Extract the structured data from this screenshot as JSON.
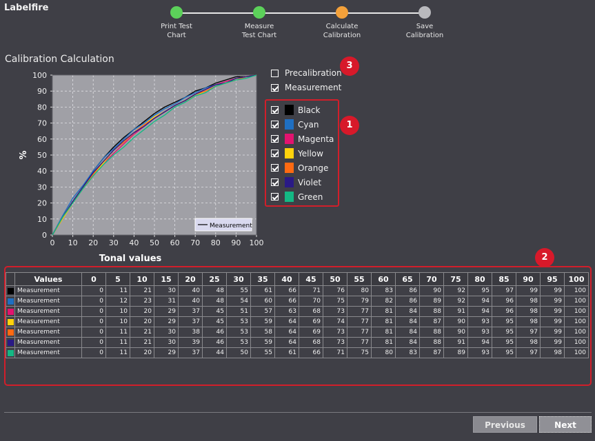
{
  "app": {
    "title": "Labelfire"
  },
  "stepper": {
    "steps": [
      {
        "label": "Print Test\nChart",
        "status": "done",
        "color": "#5cd15a"
      },
      {
        "label": "Measure\nTest Chart",
        "status": "done",
        "color": "#5cd15a"
      },
      {
        "label": "Calculate\nCalibration",
        "status": "current",
        "color": "#f4a13a"
      },
      {
        "label": "Save\nCalibration",
        "status": "pending",
        "color": "#b9b9bd"
      }
    ]
  },
  "section": {
    "title": "Calibration Calculation"
  },
  "options": {
    "precalibration": {
      "label": "Precalibration",
      "checked": false
    },
    "measurement": {
      "label": "Measurement",
      "checked": true
    }
  },
  "colors": [
    {
      "label": "Black",
      "swatch": "#000000",
      "checked": true
    },
    {
      "label": "Cyan",
      "swatch": "#1f6fc2",
      "checked": true
    },
    {
      "label": "Magenta",
      "swatch": "#e2136f",
      "checked": true
    },
    {
      "label": "Yellow",
      "swatch": "#ffd20c",
      "checked": true
    },
    {
      "label": "Orange",
      "swatch": "#ff6a12",
      "checked": true
    },
    {
      "label": "Violet",
      "swatch": "#2a1a86",
      "checked": true
    },
    {
      "label": "Green",
      "swatch": "#14b884",
      "checked": true
    }
  ],
  "badges": {
    "b1": "1",
    "b2": "2",
    "b3": "3"
  },
  "chart_data": {
    "type": "line",
    "ylabel": "%",
    "xlabel": "Tonal values",
    "xlim": [
      0,
      100
    ],
    "ylim": [
      0,
      100
    ],
    "x_ticks": [
      0,
      10,
      20,
      30,
      40,
      50,
      60,
      70,
      80,
      90,
      100
    ],
    "y_ticks": [
      0,
      10,
      20,
      30,
      40,
      50,
      60,
      70,
      80,
      90,
      100
    ],
    "grid": true,
    "legend": {
      "label": "Measurement",
      "position": "bottom-right"
    },
    "x": [
      0,
      5,
      10,
      15,
      20,
      25,
      30,
      35,
      40,
      45,
      50,
      55,
      60,
      65,
      70,
      75,
      80,
      85,
      90,
      95,
      100
    ],
    "series": [
      {
        "color": "#000000",
        "values": [
          0,
          11,
          21,
          30,
          40,
          48,
          55,
          61,
          66,
          71,
          76,
          80,
          83,
          86,
          90,
          92,
          95,
          97,
          99,
          99,
          100
        ]
      },
      {
        "color": "#1f6fc2",
        "values": [
          0,
          12,
          23,
          31,
          40,
          48,
          54,
          60,
          66,
          70,
          75,
          79,
          82,
          86,
          89,
          92,
          94,
          96,
          98,
          99,
          100
        ]
      },
      {
        "color": "#e2136f",
        "values": [
          0,
          10,
          20,
          29,
          37,
          45,
          51,
          57,
          63,
          68,
          73,
          77,
          81,
          84,
          88,
          91,
          94,
          96,
          98,
          99,
          100
        ]
      },
      {
        "color": "#ffd20c",
        "values": [
          0,
          10,
          20,
          29,
          37,
          45,
          53,
          59,
          64,
          69,
          74,
          77,
          81,
          84,
          87,
          90,
          93,
          95,
          98,
          99,
          100
        ]
      },
      {
        "color": "#ff6a12",
        "values": [
          0,
          11,
          21,
          30,
          38,
          46,
          53,
          58,
          64,
          69,
          73,
          77,
          81,
          84,
          88,
          90,
          93,
          95,
          97,
          99,
          100
        ]
      },
      {
        "color": "#2a1a86",
        "values": [
          0,
          11,
          21,
          30,
          39,
          46,
          53,
          59,
          64,
          68,
          73,
          77,
          81,
          84,
          88,
          91,
          94,
          95,
          98,
          99,
          100
        ]
      },
      {
        "color": "#14b884",
        "values": [
          0,
          11,
          20,
          29,
          37,
          44,
          50,
          55,
          61,
          66,
          71,
          75,
          80,
          83,
          87,
          89,
          93,
          95,
          97,
          98,
          100
        ]
      }
    ]
  },
  "table": {
    "header_label": "Values",
    "columns": [
      "0",
      "5",
      "10",
      "15",
      "20",
      "25",
      "30",
      "35",
      "40",
      "45",
      "50",
      "55",
      "60",
      "65",
      "70",
      "75",
      "80",
      "85",
      "90",
      "95",
      "100"
    ],
    "rows": [
      {
        "swatch": "#000000",
        "name": "Measurement",
        "values": [
          "0",
          "11",
          "21",
          "30",
          "40",
          "48",
          "55",
          "61",
          "66",
          "71",
          "76",
          "80",
          "83",
          "86",
          "90",
          "92",
          "95",
          "97",
          "99",
          "99",
          "100"
        ]
      },
      {
        "swatch": "#1f6fc2",
        "name": "Measurement",
        "values": [
          "0",
          "12",
          "23",
          "31",
          "40",
          "48",
          "54",
          "60",
          "66",
          "70",
          "75",
          "79",
          "82",
          "86",
          "89",
          "92",
          "94",
          "96",
          "98",
          "99",
          "100"
        ]
      },
      {
        "swatch": "#e2136f",
        "name": "Measurement",
        "values": [
          "0",
          "10",
          "20",
          "29",
          "37",
          "45",
          "51",
          "57",
          "63",
          "68",
          "73",
          "77",
          "81",
          "84",
          "88",
          "91",
          "94",
          "96",
          "98",
          "99",
          "100"
        ]
      },
      {
        "swatch": "#ffd20c",
        "name": "Measurement",
        "values": [
          "0",
          "10",
          "20",
          "29",
          "37",
          "45",
          "53",
          "59",
          "64",
          "69",
          "74",
          "77",
          "81",
          "84",
          "87",
          "90",
          "93",
          "95",
          "98",
          "99",
          "100"
        ]
      },
      {
        "swatch": "#ff6a12",
        "name": "Measurement",
        "values": [
          "0",
          "11",
          "21",
          "30",
          "38",
          "46",
          "53",
          "58",
          "64",
          "69",
          "73",
          "77",
          "81",
          "84",
          "88",
          "90",
          "93",
          "95",
          "97",
          "99",
          "100"
        ]
      },
      {
        "swatch": "#2a1a86",
        "name": "Measurement",
        "values": [
          "0",
          "11",
          "21",
          "30",
          "39",
          "46",
          "53",
          "59",
          "64",
          "68",
          "73",
          "77",
          "81",
          "84",
          "88",
          "91",
          "94",
          "95",
          "98",
          "99",
          "100"
        ]
      },
      {
        "swatch": "#14b884",
        "name": "Measurement",
        "values": [
          "0",
          "11",
          "20",
          "29",
          "37",
          "44",
          "50",
          "55",
          "61",
          "66",
          "71",
          "75",
          "80",
          "83",
          "87",
          "89",
          "93",
          "95",
          "97",
          "98",
          "100"
        ]
      }
    ]
  },
  "buttons": {
    "previous": "Previous",
    "next": "Next"
  }
}
